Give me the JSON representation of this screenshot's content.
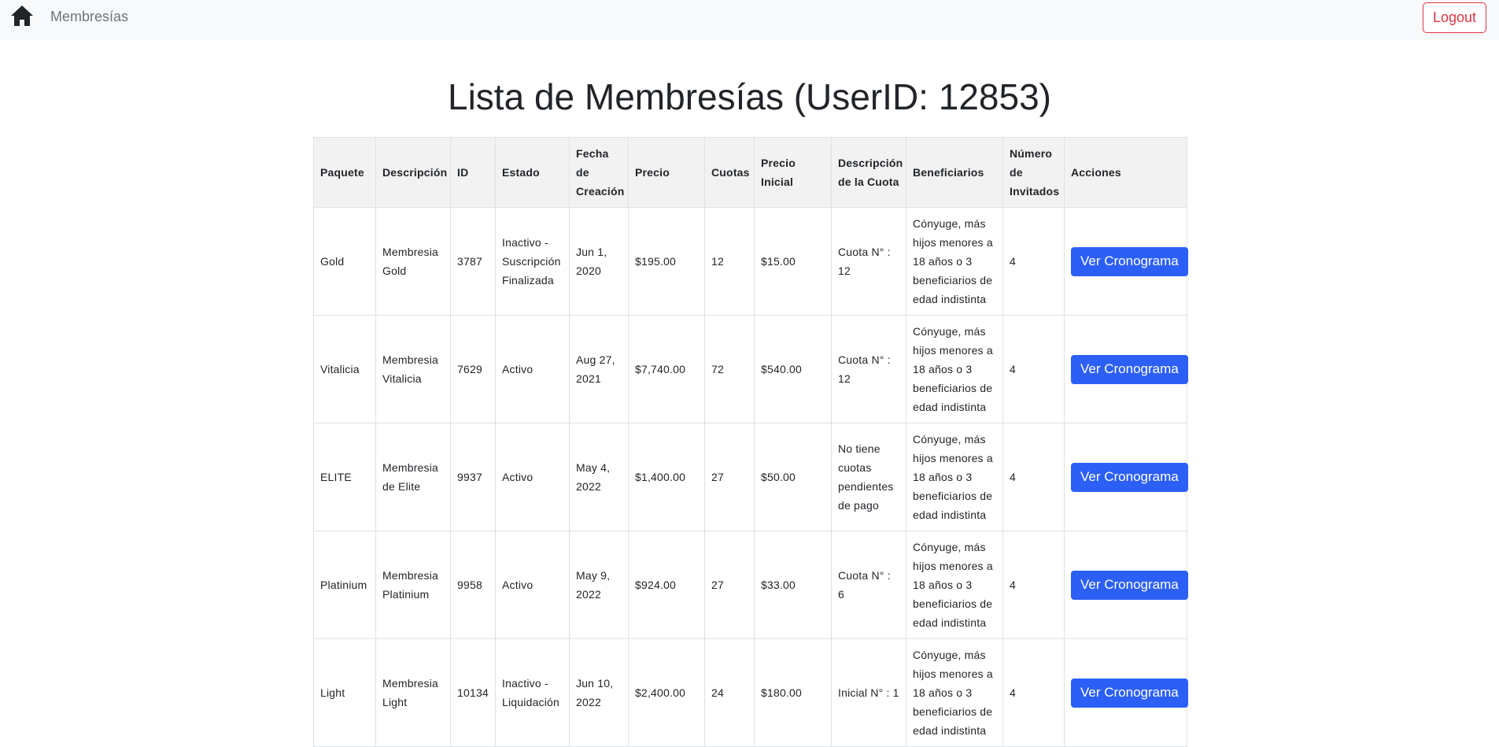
{
  "navbar": {
    "home_icon": "home-icon",
    "brand": "Membresías",
    "logout_label": "Logout"
  },
  "page": {
    "title": "Lista de Membresías (UserID: 12853)"
  },
  "colors": {
    "primary_button": "#2c5ff6",
    "logout_border": "#dc3545",
    "navbar_bg": "#f8f9fa",
    "header_bg": "#f2f2f2"
  },
  "table": {
    "headers": [
      "Paquete",
      "Descripción",
      "ID",
      "Estado",
      "Fecha de Creación",
      "Precio",
      "Cuotas",
      "Precio Inicial",
      "Descripción de la Cuota",
      "Beneficiarios",
      "Número de Invitados",
      "Acciones"
    ],
    "rows": [
      {
        "paquete": "Gold",
        "descripcion": "Membresia Gold",
        "id": "3787",
        "estado": "Inactivo - Suscripción Finalizada",
        "fecha": "Jun 1, 2020",
        "precio": "$195.00",
        "cuotas": "12",
        "precio_inicial": "$15.00",
        "desc_cuota": "Cuota N° : 12",
        "beneficiarios": "Cónyuge, más hijos menores a 18 años o 3 beneficiarios de edad indistinta",
        "invitados": "4",
        "accion": "Ver Cronograma"
      },
      {
        "paquete": "Vitalicia",
        "descripcion": "Membresia Vitalicia",
        "id": "7629",
        "estado": "Activo",
        "fecha": "Aug 27, 2021",
        "precio": "$7,740.00",
        "cuotas": "72",
        "precio_inicial": "$540.00",
        "desc_cuota": "Cuota N° : 12",
        "beneficiarios": "Cónyuge, más hijos menores a 18 años o 3 beneficiarios de edad indistinta",
        "invitados": "4",
        "accion": "Ver Cronograma"
      },
      {
        "paquete": "ELITE",
        "descripcion": "Membresia de Elite",
        "id": "9937",
        "estado": "Activo",
        "fecha": "May 4, 2022",
        "precio": "$1,400.00",
        "cuotas": "27",
        "precio_inicial": "$50.00",
        "desc_cuota": "No tiene cuotas pendientes de pago",
        "beneficiarios": "Cónyuge, más hijos menores a 18 años o 3 beneficiarios de edad indistinta",
        "invitados": "4",
        "accion": "Ver Cronograma"
      },
      {
        "paquete": "Platinium",
        "descripcion": "Membresia Platinium",
        "id": "9958",
        "estado": "Activo",
        "fecha": "May 9, 2022",
        "precio": "$924.00",
        "cuotas": "27",
        "precio_inicial": "$33.00",
        "desc_cuota": "Cuota N° : 6",
        "beneficiarios": "Cónyuge, más hijos menores a 18 años o 3 beneficiarios de edad indistinta",
        "invitados": "4",
        "accion": "Ver Cronograma"
      },
      {
        "paquete": "Light",
        "descripcion": "Membresia Light",
        "id": "10134",
        "estado": "Inactivo - Liquidación",
        "fecha": "Jun 10, 2022",
        "precio": "$2,400.00",
        "cuotas": "24",
        "precio_inicial": "$180.00",
        "desc_cuota": "Inicial N° : 1",
        "beneficiarios": "Cónyuge, más hijos menores a 18 años o 3 beneficiarios de edad indistinta",
        "invitados": "4",
        "accion": "Ver Cronograma"
      }
    ]
  }
}
